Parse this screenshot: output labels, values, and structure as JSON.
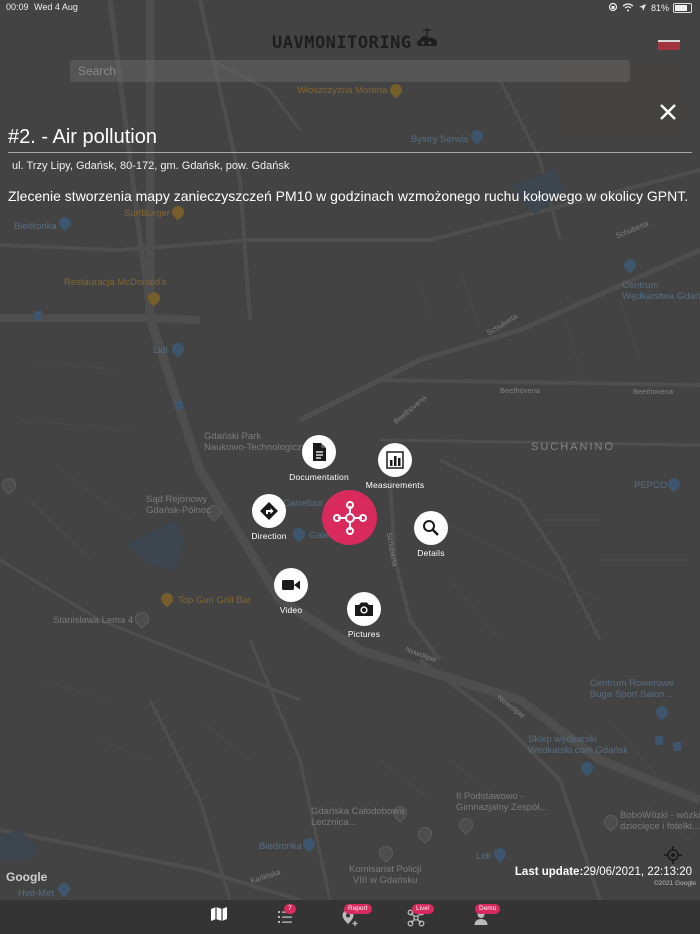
{
  "status_bar": {
    "time": "00:09",
    "date": "Wed 4 Aug",
    "battery": "81%",
    "battery_level": 0.81
  },
  "header": {
    "logo_text": "UAVMONITORING",
    "search_placeholder": "Search"
  },
  "map": {
    "street_labels": [
      "Beethovena",
      "Beethovena",
      "Schuberta",
      "Schuberta",
      "Nowolipie",
      "Nowolipie",
      "Karlińska",
      "Schuberta",
      "Beethovena"
    ],
    "district": "SUCHANINO",
    "pois": [
      {
        "name": "Włoszczyzna Morena",
        "kind": "orange"
      },
      {
        "name": "Bystry Serwis",
        "kind": "blue"
      },
      {
        "name": "Biedronka",
        "kind": "blue"
      },
      {
        "name": "SurfBurger",
        "kind": "orange"
      },
      {
        "name": "Restauracja McDonald's",
        "kind": "orange"
      },
      {
        "name": "Lidl",
        "kind": "blue"
      },
      {
        "name": "Centrum\nWędkarstwa Gdańsk",
        "kind": "blue"
      },
      {
        "name": "Gdański Park\nNaukowo-Technologiczny",
        "kind": "gray"
      },
      {
        "name": "Sąd Rejonowy\nGdańsk-Północ",
        "kind": "gray"
      },
      {
        "name": "Carrefour",
        "kind": "blue"
      },
      {
        "name": "Galeria",
        "kind": "blue"
      },
      {
        "name": "PEPCO",
        "kind": "blue"
      },
      {
        "name": "Top Gun Grill Bar",
        "kind": "orange"
      },
      {
        "name": "Stanisława Lema 4",
        "kind": "gray"
      },
      {
        "name": "Centrum Rowerowe\nBuga Sport Salon...",
        "kind": "blue"
      },
      {
        "name": "Sklep wędkarski\nWedkarski.com Gdańsk",
        "kind": "blue"
      },
      {
        "name": "II Podstawowo -\nGimnazjalny Zespół...",
        "kind": "gray"
      },
      {
        "name": "BoboWózki - wózki\ndziecięce i fotelki...",
        "kind": "gray"
      },
      {
        "name": "Gdańska Całodobowa\nLecznica...",
        "kind": "gray"
      },
      {
        "name": "Biedronka",
        "kind": "blue"
      },
      {
        "name": "Komisariat Policji\nVIII w Gdańsku",
        "kind": "gray"
      },
      {
        "name": "Lidl",
        "kind": "blue"
      },
      {
        "name": "Hvd-Met",
        "kind": "blue"
      }
    ],
    "google_label": "Google",
    "copyright": "©2021 Google"
  },
  "detail": {
    "title": "#2. - Air pollution",
    "address": "ul. Trzy Lipy, Gdańsk, 80-172, gm. Gdańsk, pow. Gdańsk",
    "description": "Zlecenie stworzenia mapy zanieczyszczeń PM10 w godzinach wzmożonego ruchu kołowego w okolicy GPNT."
  },
  "radial_menu": {
    "documentation": "Documentation",
    "measurements": "Measurements",
    "direction": "Direction",
    "details": "Details",
    "video": "Video",
    "pictures": "Pictures"
  },
  "last_update": {
    "label": "Last update:",
    "value": "29/06/2021, 22:13:20"
  },
  "tab_bar": {
    "tasks_badge": "7",
    "report_badge": "Report",
    "live_badge": "Live!",
    "demo_badge": "Demo"
  },
  "colors": {
    "accent": "#d92a5e",
    "flag": "#a3353e",
    "background": "#4a4a4a"
  }
}
